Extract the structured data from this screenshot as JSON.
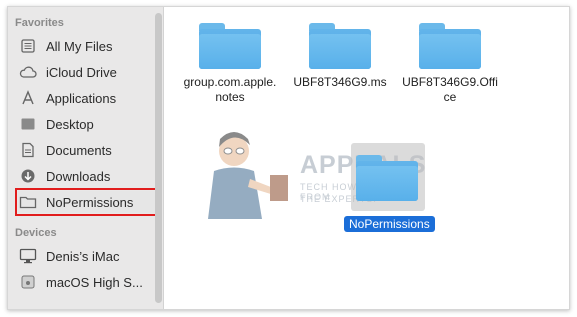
{
  "sidebar": {
    "favorites_title": "Favorites",
    "favorites": [
      {
        "label": "All My Files",
        "icon": "all-files-icon"
      },
      {
        "label": "iCloud Drive",
        "icon": "cloud-icon"
      },
      {
        "label": "Applications",
        "icon": "applications-icon"
      },
      {
        "label": "Desktop",
        "icon": "desktop-icon"
      },
      {
        "label": "Documents",
        "icon": "document-icon"
      },
      {
        "label": "Downloads",
        "icon": "download-icon"
      },
      {
        "label": "NoPermissions",
        "icon": "folder-icon",
        "highlighted": true
      }
    ],
    "devices_title": "Devices",
    "devices": [
      {
        "label": "Denis’s iMac",
        "icon": "imac-icon"
      },
      {
        "label": "macOS High S...",
        "icon": "disk-icon"
      }
    ]
  },
  "files": [
    {
      "name_line1": "group.com.apple.",
      "name_line2": "notes"
    },
    {
      "name_line1": "UBF8T346G9.ms",
      "name_line2": ""
    },
    {
      "name_line1": "UBF8T346G9.Offi",
      "name_line2": "ce"
    }
  ],
  "dragged": {
    "label": "NoPermissions"
  },
  "watermark": {
    "title": "APPUALS",
    "line1": "TECH HOW-TO'S FROM",
    "line2": "THE EXPERTS!"
  },
  "colors": {
    "highlight": "#e11d1d",
    "selection": "#1b6ed8",
    "folder": "#5fb3ea"
  }
}
